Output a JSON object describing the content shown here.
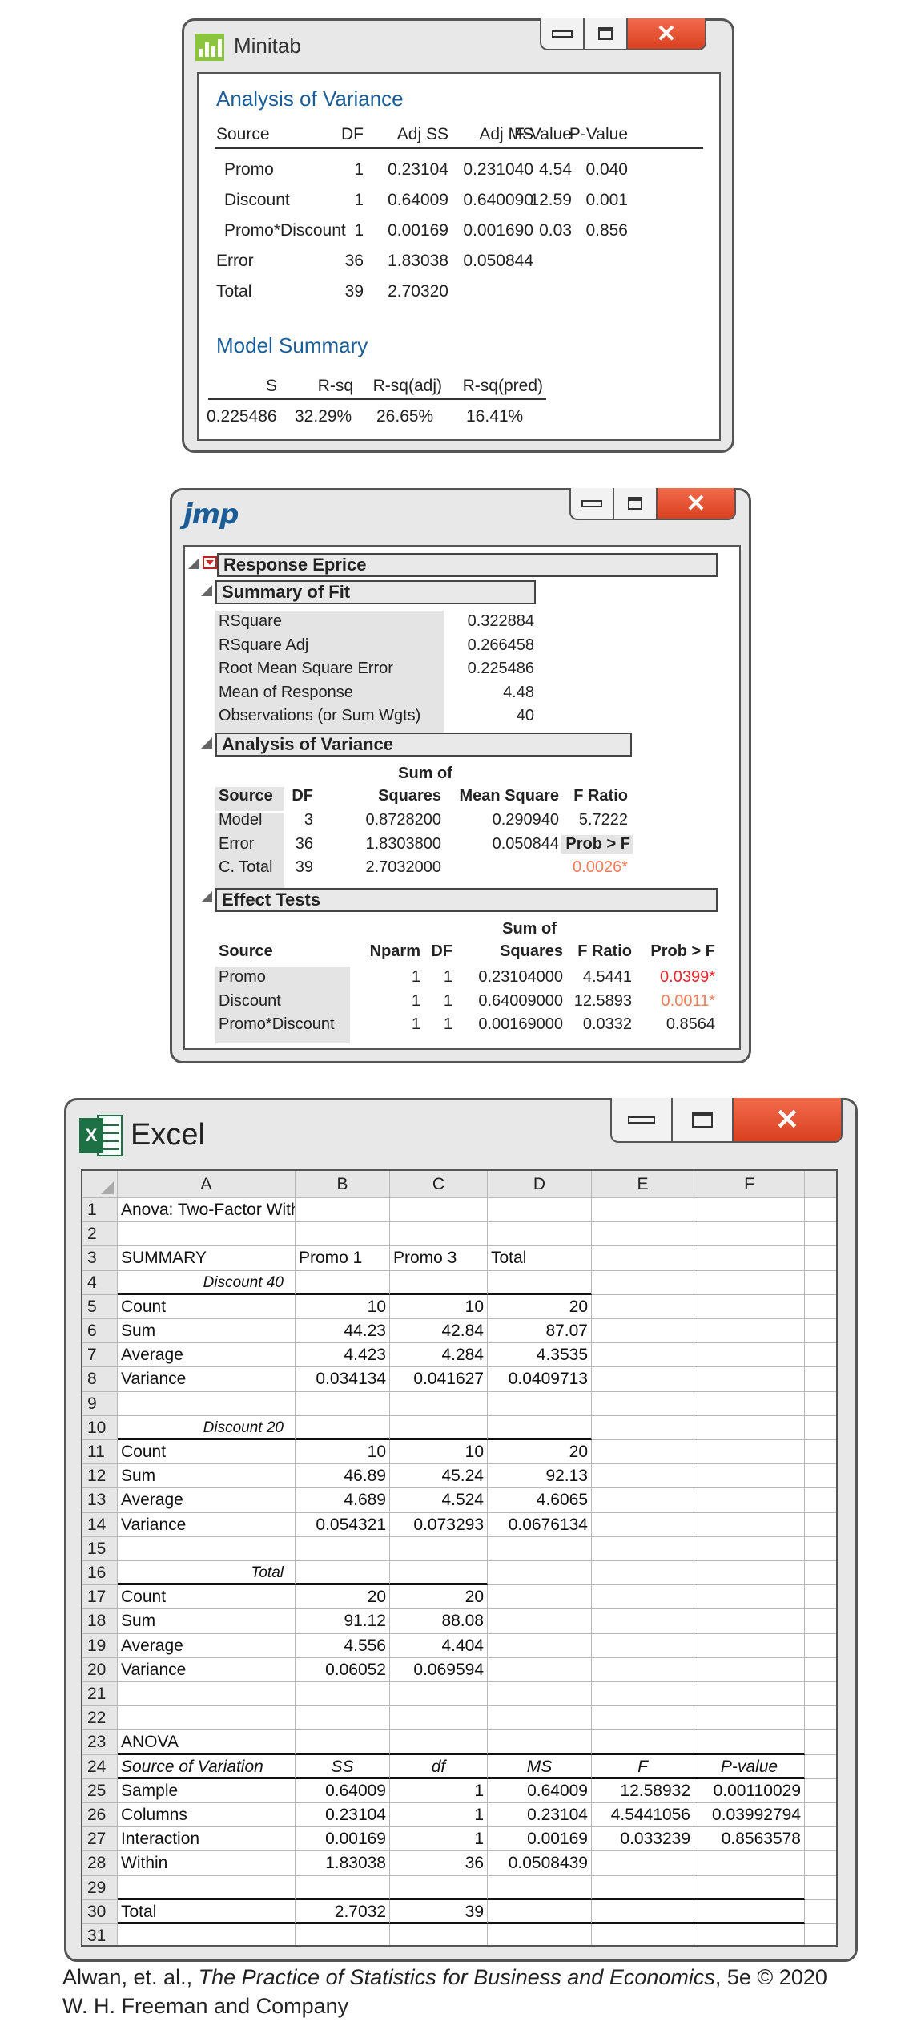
{
  "minitab": {
    "app_title": "Minitab",
    "anova_heading": "Analysis of Variance",
    "anova_headers": [
      "Source",
      "DF",
      "Adj SS",
      "Adj MS",
      "F-Value",
      "P-Value"
    ],
    "anova_rows": [
      [
        "Promo",
        "1",
        "0.23104",
        "0.231040",
        "4.54",
        "0.040"
      ],
      [
        "Discount",
        "1",
        "0.64009",
        "0.640090",
        "12.59",
        "0.001"
      ],
      [
        "Promo*Discount",
        "1",
        "0.00169",
        "0.001690",
        "0.03",
        "0.856"
      ],
      [
        "Error",
        "36",
        "1.83038",
        "0.050844",
        "",
        ""
      ],
      [
        "Total",
        "39",
        "2.70320",
        "",
        "",
        ""
      ]
    ],
    "model_heading": "Model Summary",
    "model_headers": [
      "S",
      "R-sq",
      "R-sq(adj)",
      "R-sq(pred)"
    ],
    "model_values": [
      "0.225486",
      "32.29%",
      "26.65%",
      "16.41%"
    ]
  },
  "jmp": {
    "logo": "jmp",
    "response_title": "Response Eprice",
    "fit_title": "Summary of Fit",
    "fit_rows": [
      [
        "RSquare",
        "0.322884"
      ],
      [
        "RSquare Adj",
        "0.266458"
      ],
      [
        "Root Mean Square Error",
        "0.225486"
      ],
      [
        "Mean of Response",
        "4.48"
      ],
      [
        "Observations (or Sum Wgts)",
        "40"
      ]
    ],
    "anova_title": "Analysis of Variance",
    "anova_hdr": {
      "source": "Source",
      "df": "DF",
      "ss_top": "Sum of",
      "ss": "Squares",
      "ms": "Mean Square",
      "f": "F Ratio"
    },
    "anova_rows": [
      [
        "Model",
        "3",
        "0.8728200",
        "0.290940",
        "5.7222"
      ],
      [
        "Error",
        "36",
        "1.8303800",
        "0.050844",
        "Prob > F"
      ],
      [
        "C. Total",
        "39",
        "2.7032000",
        "",
        "0.0026*"
      ]
    ],
    "effects_title": "Effect Tests",
    "effects_hdr": {
      "source": "Source",
      "nparm": "Nparm",
      "df": "DF",
      "ss_top": "Sum of",
      "ss": "Squares",
      "f": "F Ratio",
      "p": "Prob > F"
    },
    "effects_rows": [
      [
        "Promo",
        "1",
        "1",
        "0.23104000",
        "4.5441",
        "0.0399*"
      ],
      [
        "Discount",
        "1",
        "1",
        "0.64009000",
        "12.5893",
        "0.0011*"
      ],
      [
        "Promo*Discount",
        "1",
        "1",
        "0.00169000",
        "0.0332",
        "0.8564"
      ]
    ],
    "colors": {
      "significant": "#e8262b",
      "significant_light": "#f47c5a"
    }
  },
  "excel": {
    "app_title": "Excel",
    "logo_letter": "X",
    "columns": [
      "A",
      "B",
      "C",
      "D",
      "E",
      "F"
    ],
    "rows": [
      [
        "Anova: Two-Factor With Replication",
        "",
        "",
        "",
        "",
        ""
      ],
      [
        "",
        "",
        "",
        "",
        "",
        ""
      ],
      [
        "SUMMARY",
        "Promo 1",
        "Promo 3",
        "Total",
        "",
        ""
      ],
      [
        "Discount 40",
        "",
        "",
        "",
        "",
        ""
      ],
      [
        "Count",
        "10",
        "10",
        "20",
        "",
        ""
      ],
      [
        "Sum",
        "44.23",
        "42.84",
        "87.07",
        "",
        ""
      ],
      [
        "Average",
        "4.423",
        "4.284",
        "4.3535",
        "",
        ""
      ],
      [
        "Variance",
        "0.034134",
        "0.041627",
        "0.0409713",
        "",
        ""
      ],
      [
        "",
        "",
        "",
        "",
        "",
        ""
      ],
      [
        "Discount 20",
        "",
        "",
        "",
        "",
        ""
      ],
      [
        "Count",
        "10",
        "10",
        "20",
        "",
        ""
      ],
      [
        "Sum",
        "46.89",
        "45.24",
        "92.13",
        "",
        ""
      ],
      [
        "Average",
        "4.689",
        "4.524",
        "4.6065",
        "",
        ""
      ],
      [
        "Variance",
        "0.054321",
        "0.073293",
        "0.0676134",
        "",
        ""
      ],
      [
        "",
        "",
        "",
        "",
        "",
        ""
      ],
      [
        "Total",
        "",
        "",
        "",
        "",
        ""
      ],
      [
        "Count",
        "20",
        "20",
        "",
        "",
        ""
      ],
      [
        "Sum",
        "91.12",
        "88.08",
        "",
        "",
        ""
      ],
      [
        "Average",
        "4.556",
        "4.404",
        "",
        "",
        ""
      ],
      [
        "Variance",
        "0.06052",
        "0.069594",
        "",
        "",
        ""
      ],
      [
        "",
        "",
        "",
        "",
        "",
        ""
      ],
      [
        "",
        "",
        "",
        "",
        "",
        ""
      ],
      [
        "ANOVA",
        "",
        "",
        "",
        "",
        ""
      ],
      [
        "Source of Variation",
        "SS",
        "df",
        "MS",
        "F",
        "P-value"
      ],
      [
        "Sample",
        "0.64009",
        "1",
        "0.64009",
        "12.58932",
        "0.00110029"
      ],
      [
        "Columns",
        "0.23104",
        "1",
        "0.23104",
        "4.5441056",
        "0.03992794"
      ],
      [
        "Interaction",
        "0.00169",
        "1",
        "0.00169",
        "0.033239",
        "0.8563578"
      ],
      [
        "Within",
        "1.83038",
        "36",
        "0.0508439",
        "",
        ""
      ],
      [
        "",
        "",
        "",
        "",
        "",
        ""
      ],
      [
        "Total",
        "2.7032",
        "39",
        "",
        "",
        ""
      ],
      [
        "",
        "",
        "",
        "",
        "",
        ""
      ]
    ]
  },
  "caption": {
    "line1_pre": "Alwan, et. al., ",
    "line1_book": "The Practice of Statistics for Business and Economics",
    "line1_post": ", 5e © 2020",
    "line2": "W. H. Freeman and Company"
  }
}
